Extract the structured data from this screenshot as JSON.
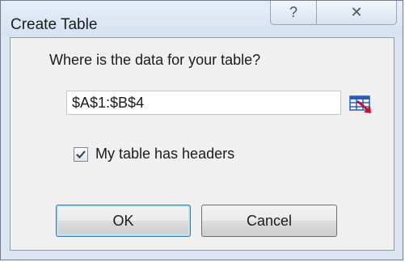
{
  "dialog": {
    "title": "Create Table",
    "help_glyph": "?",
    "close_glyph": "✕"
  },
  "form": {
    "prompt": "Where is the data for your table?",
    "range_value": "$A$1:$B$4",
    "headers_checkbox": {
      "label": "My table has headers",
      "checked": true
    }
  },
  "buttons": {
    "ok": "OK",
    "cancel": "Cancel"
  },
  "icons": {
    "help": "help-icon",
    "close": "close-icon",
    "range_selector": "collapse-dialog-range-icon",
    "checkmark": "checkmark-icon"
  },
  "colors": {
    "frame": "#dce6f3",
    "client": "#f0f0f0",
    "ok_focus_border": "#3c7fb1",
    "range_icon_grid": "#2a5bb8",
    "range_icon_arrow": "#c8102e"
  }
}
